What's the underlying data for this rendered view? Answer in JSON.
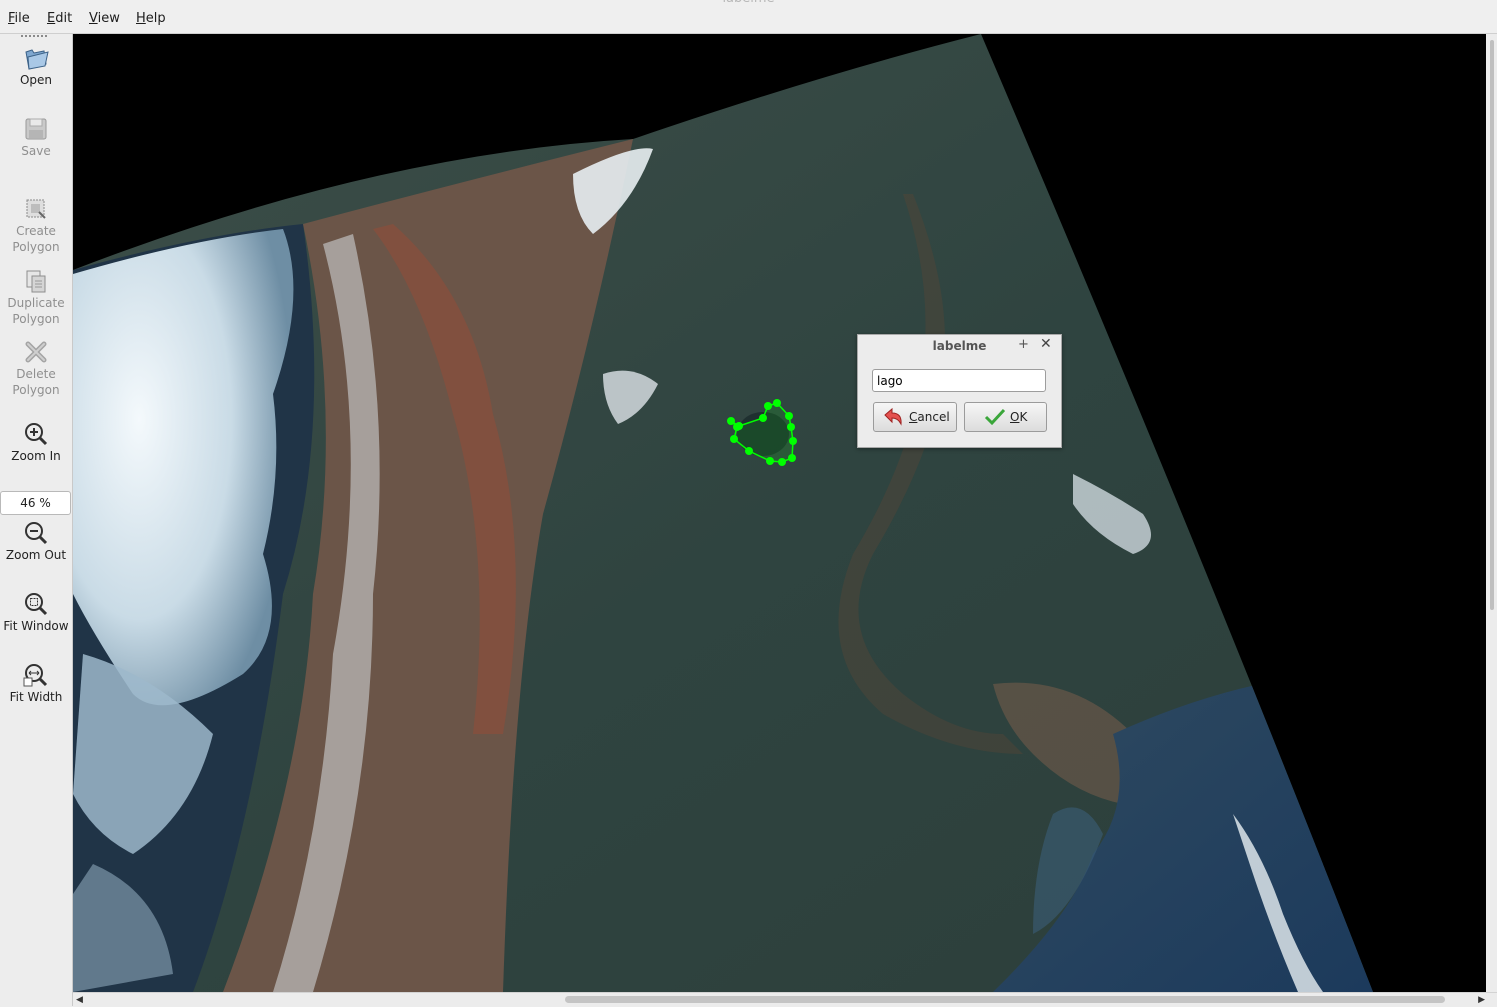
{
  "window": {
    "title": "labelme"
  },
  "menu": [
    "File",
    "Edit",
    "View",
    "Help"
  ],
  "toolbar": {
    "open": "Open",
    "save": "Save",
    "create_polygon": [
      "Create",
      "Polygon"
    ],
    "duplicate_polygon": [
      "Duplicate",
      "Polygon"
    ],
    "delete_polygon": [
      "Delete",
      "Polygon"
    ],
    "zoom_in": "Zoom In",
    "zoom_value": "46 %",
    "zoom_out": "Zoom Out",
    "fit_window": "Fit Window",
    "fit_width": "Fit Width"
  },
  "polygon": {
    "color": "#00ff00",
    "vertex_count": 14
  },
  "dialog": {
    "title": "labelme",
    "input_value": "lago",
    "cancel_label": "Cancel",
    "ok_label": "OK"
  },
  "colors": {
    "canvas_bg": "#000000",
    "polygon": "#00ff00",
    "chrome": "#ededed"
  }
}
